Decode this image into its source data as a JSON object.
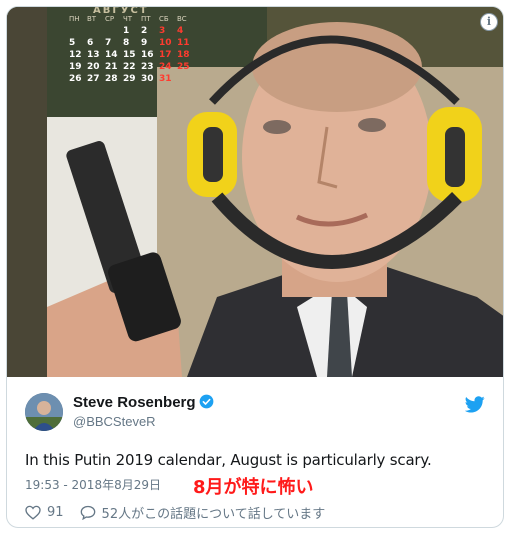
{
  "photo": {
    "alt_description": "",
    "calendar": {
      "month_label": "АВГУСТ",
      "weekday_labels": [
        "ПН",
        "ВТ",
        "СР",
        "ЧТ",
        "ПТ",
        "СБ",
        "ВС"
      ],
      "weeks": [
        [
          "",
          "",
          "",
          "1",
          "2",
          "3",
          "4"
        ],
        [
          "5",
          "6",
          "7",
          "8",
          "9",
          "10",
          "11"
        ],
        [
          "12",
          "13",
          "14",
          "15",
          "16",
          "17",
          "18"
        ],
        [
          "19",
          "20",
          "21",
          "22",
          "23",
          "24",
          "25"
        ],
        [
          "26",
          "27",
          "28",
          "29",
          "30",
          "31",
          ""
        ]
      ]
    }
  },
  "tweet": {
    "author_name": "Steve Rosenberg",
    "author_handle": "@BBCSteveR",
    "text": "In this Putin 2019 calendar, August is particularly scary.",
    "timestamp": "19:53 - 2018年8月29日",
    "overlay_caption": "8月が特に怖い",
    "like_count": "91",
    "conversation_text": "52人がこの話題について話しています"
  },
  "colors": {
    "link_blue": "#1da1f2",
    "overlay_red": "#ff1a1a",
    "calendar_weekend": "#ff3b2f"
  },
  "icons": [
    "info-icon",
    "verified-badge-icon",
    "twitter-bird-icon",
    "heart-icon",
    "speech-bubble-icon"
  ]
}
